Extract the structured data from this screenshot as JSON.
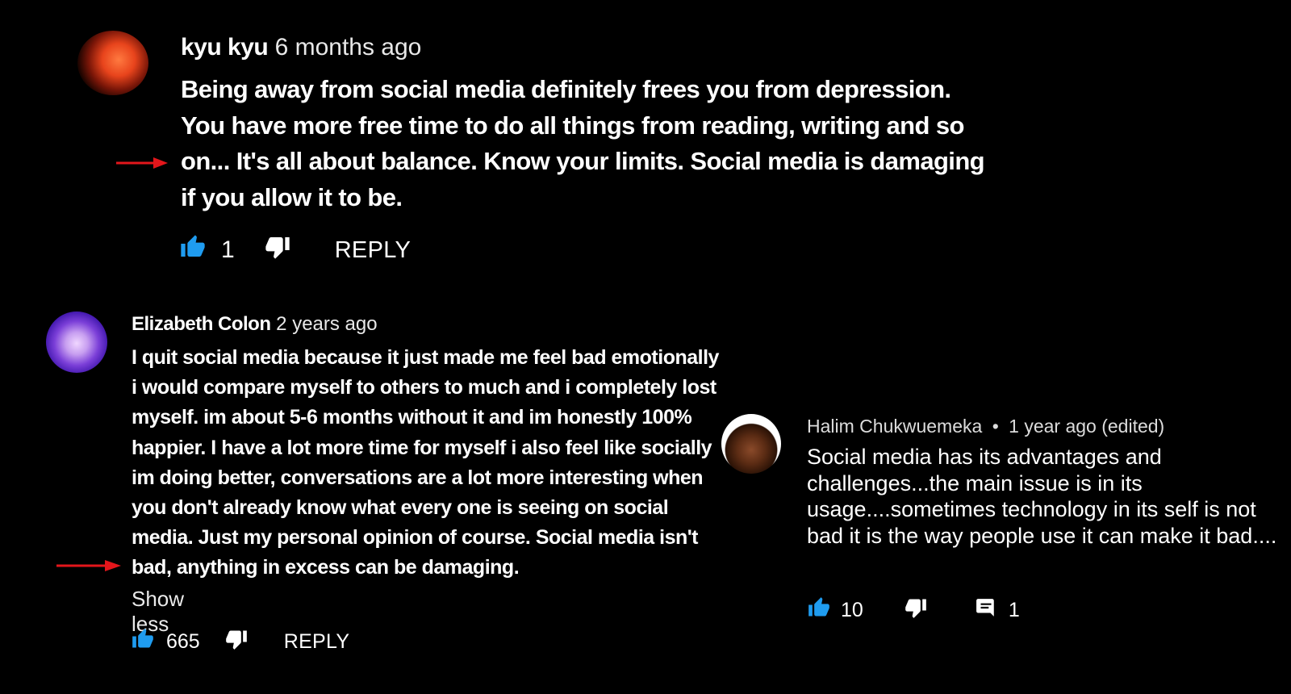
{
  "colors": {
    "background": "#000000",
    "text": "#ffffff",
    "like_icon": "#1f9cf0",
    "arrow": "#e3161b"
  },
  "icons": {
    "like": "thumbs-up-icon",
    "dislike": "thumbs-down-icon",
    "replies": "comment-bubble-icon",
    "annotation": "red-arrow-icon"
  },
  "comments": [
    {
      "author": "kyu kyu",
      "time": "6 months ago",
      "text": "Being away from social media definitely frees you from depression. You have more free time to do all things from reading, writing and so on... It's all about balance. Know your limits. Social media is damaging if you allow it to be.",
      "likes": "1",
      "reply_label": "REPLY"
    },
    {
      "author": "Elizabeth Colon",
      "time": "2 years ago",
      "text": "I quit social media because it just made me feel bad emotionally i would compare myself to others to much and i completely lost myself. im about 5-6 months without it and im honestly 100% happier. I have a lot more time for myself i also feel like socially im doing better, conversations are a lot more interesting when you don't already know what every one is seeing on social media. Just my personal opinion of course. Social media isn't bad, anything in excess can be damaging.",
      "show_less": "Show less",
      "likes": "665",
      "reply_label": "REPLY"
    },
    {
      "author": "Halim Chukwuemeka",
      "separator": "•",
      "time": "1 year ago (edited)",
      "text": "Social media has its advantages and challenges...the main issue is in its usage....sometimes technology in its self is not bad it is the way people use it can make it bad....",
      "likes": "10",
      "replies": "1"
    }
  ]
}
